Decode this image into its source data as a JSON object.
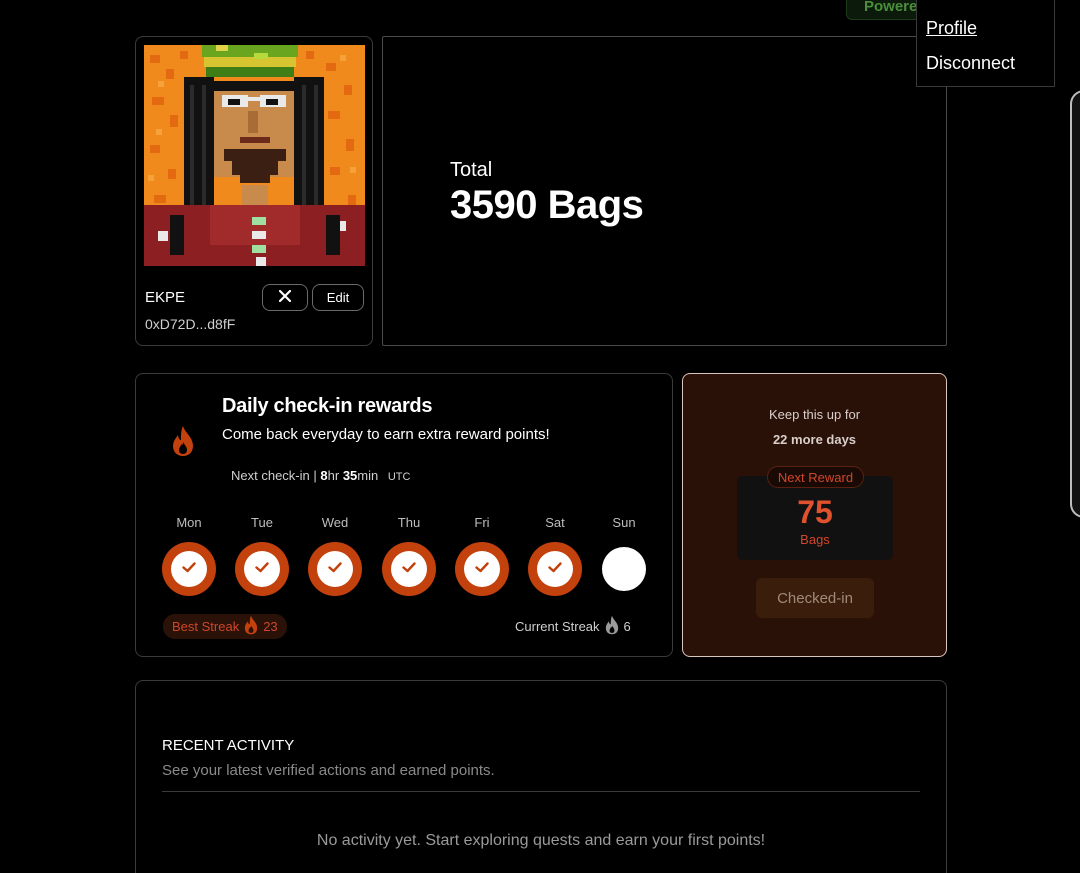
{
  "header": {
    "powered_label": "Powere"
  },
  "account_menu": {
    "items": [
      {
        "label": "Profile"
      },
      {
        "label": "Disconnect"
      }
    ]
  },
  "profile": {
    "name": "EKPE",
    "address": "0xD72D...d8fF",
    "edit_label": "Edit",
    "close_icon": "close-icon"
  },
  "total": {
    "label": "Total",
    "value": "3590 Bags"
  },
  "checkin": {
    "title": "Daily check-in rewards",
    "subtitle": "Come back everyday to earn extra reward points!",
    "next_label": "Next check-in",
    "separator": "|",
    "hours": "8",
    "hours_unit": "hr",
    "minutes": "35",
    "minutes_unit": "min",
    "timezone": "UTC",
    "days": [
      {
        "label": "Mon",
        "checked": true
      },
      {
        "label": "Tue",
        "checked": true
      },
      {
        "label": "Wed",
        "checked": true
      },
      {
        "label": "Thu",
        "checked": true
      },
      {
        "label": "Fri",
        "checked": true
      },
      {
        "label": "Sat",
        "checked": true
      },
      {
        "label": "Sun",
        "checked": false
      }
    ],
    "best_streak_label": "Best Streak",
    "best_streak_value": "23",
    "current_streak_label": "Current Streak",
    "current_streak_value": "6",
    "accent_color": "#c2410c"
  },
  "streak": {
    "keep_label": "Keep this up for",
    "days_more": "22 more days",
    "next_reward_label": "Next Reward",
    "reward_value": "75",
    "reward_unit": "Bags",
    "button_label": "Checked-in"
  },
  "activity": {
    "title": "RECENT ACTIVITY",
    "subtitle": "See your latest verified actions and earned points.",
    "empty_message": "No activity yet. Start exploring quests and earn your first points!"
  }
}
